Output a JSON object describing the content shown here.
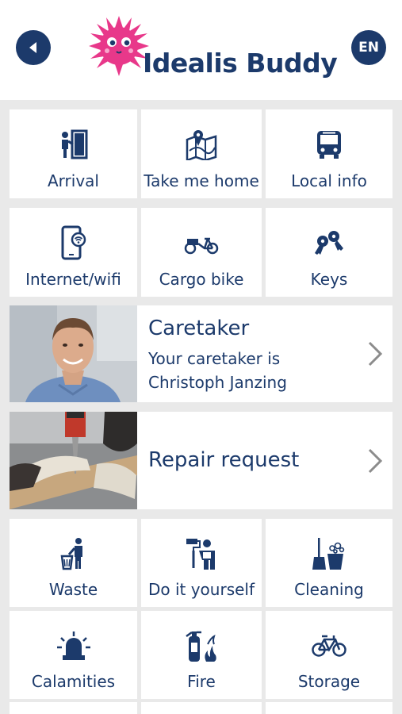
{
  "header": {
    "brand": "Idealis Buddy",
    "language": "EN",
    "back_icon": "back-arrow-icon",
    "brand_color": "#e8388a",
    "accent_color": "#1c3a6b"
  },
  "row1": [
    {
      "label": "Arrival",
      "icon": "door-arrival-icon"
    },
    {
      "label": "Take me home",
      "icon": "map-icon"
    },
    {
      "label": "Local info",
      "icon": "bus-icon"
    }
  ],
  "row2": [
    {
      "label": "Internet/wifi",
      "icon": "phone-wifi-icon"
    },
    {
      "label": "Cargo bike",
      "icon": "cargo-bike-icon"
    },
    {
      "label": "Keys",
      "icon": "keys-icon"
    }
  ],
  "caretaker": {
    "title": "Caretaker",
    "line1": "Your caretaker is",
    "line2": "Christoph Janzing"
  },
  "repair": {
    "title": "Repair request"
  },
  "row3": [
    {
      "label": "Waste",
      "icon": "waste-icon"
    },
    {
      "label": "Do it yourself",
      "icon": "diy-icon"
    },
    {
      "label": "Cleaning",
      "icon": "cleaning-icon"
    }
  ],
  "row4": [
    {
      "label": "Calamities",
      "icon": "alarm-icon"
    },
    {
      "label": "Fire",
      "icon": "fire-extinguisher-icon"
    },
    {
      "label": "Storage",
      "icon": "bicycle-icon"
    }
  ]
}
